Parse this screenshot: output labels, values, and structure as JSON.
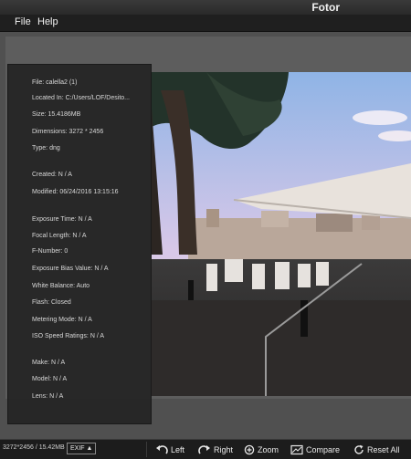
{
  "app": {
    "title": "Fotor"
  },
  "menu": {
    "file": "File",
    "help": "Help"
  },
  "info_panel": {
    "file": "File: calella2 (1)",
    "located_in": "Located In: C:/Users/LOF/Desito...",
    "size": "Size: 15.4186MB",
    "dimensions": "Dimensions: 3272 * 2456",
    "type": "Type: dng",
    "created": "Created: N / A",
    "modified": "Modified: 06/24/2016 13:15:16",
    "exposure_time": "Exposure Time: N / A",
    "focal_length": "Focal Length: N / A",
    "f_number": "F-Number: 0",
    "exposure_bias": "Exposure Bias Value: N / A",
    "white_balance": "White Balance: Auto",
    "flash": "Flash: Closed",
    "metering_mode": "Metering Mode: N / A",
    "iso": "ISO Speed Ratings: N / A",
    "make": "Make: N / A",
    "model": "Model: N / A",
    "lens": "Lens: N / A"
  },
  "status": {
    "dimensions_size": "3272*2456 / 15.42MB",
    "exif_label": "EXIF"
  },
  "toolbar": {
    "left": "Left",
    "right": "Right",
    "zoom": "Zoom",
    "compare": "Compare",
    "reset_all": "Reset All"
  }
}
